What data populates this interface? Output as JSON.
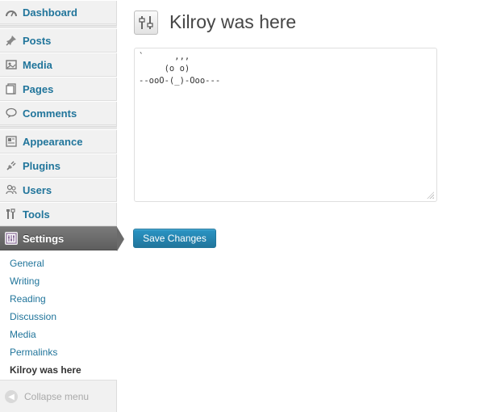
{
  "menu": {
    "dashboard": {
      "label": "Dashboard",
      "icon": "dashboard-icon"
    },
    "posts": {
      "label": "Posts",
      "icon": "pushpin-icon"
    },
    "media": {
      "label": "Media",
      "icon": "media-icon"
    },
    "pages": {
      "label": "Pages",
      "icon": "pages-icon"
    },
    "comments": {
      "label": "Comments",
      "icon": "comment-bubble-icon"
    },
    "appearance": {
      "label": "Appearance",
      "icon": "appearance-icon"
    },
    "plugins": {
      "label": "Plugins",
      "icon": "plug-icon"
    },
    "users": {
      "label": "Users",
      "icon": "users-icon"
    },
    "tools": {
      "label": "Tools",
      "icon": "tools-icon"
    },
    "settings": {
      "label": "Settings",
      "icon": "settings-icon"
    }
  },
  "submenu": {
    "items": [
      "General",
      "Writing",
      "Reading",
      "Discussion",
      "Media",
      "Permalinks",
      "Kilroy was here"
    ],
    "current": "Kilroy was here"
  },
  "collapse_label": "Collapse menu",
  "page_title": "Kilroy was here",
  "content_text": "`      ,,,\n     (o o)\n--ooO-(_)-Ooo---",
  "save_label": "Save Changes",
  "colors": {
    "link": "#21759b",
    "button_blue": "#21759b",
    "active_menu_bg": "#6b6b6b",
    "sidebar_bg": "#f1f1f1"
  }
}
